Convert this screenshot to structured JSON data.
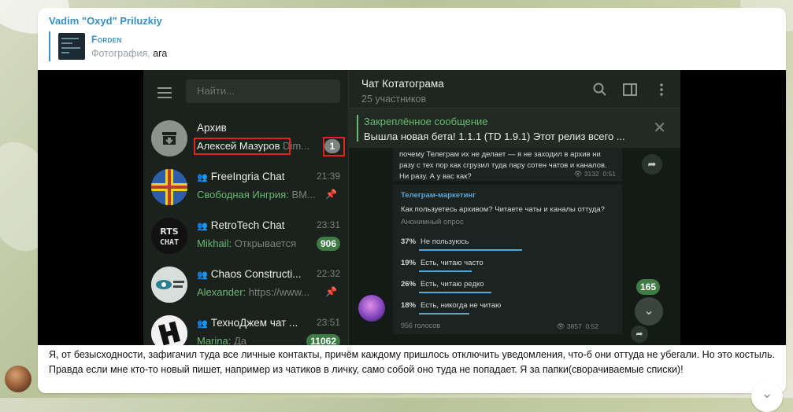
{
  "message": {
    "sender": "Vadim \"Oxyd\" Priluzkiy",
    "reply": {
      "title": "Forden",
      "type": "Фотография,",
      "text": "ага"
    },
    "caption": "Я, от безысходности, зафигачил туда все личные контакты, причём каждому пришлось отключить уведомления, что-б они оттуда не убегали. Но это костыль. Правда если мне кто-то новый пишет, например из чатиков в личку, само собой оно туда не попадает. Я за папки(сворачиваемые списки)!"
  },
  "screenshot": {
    "search_placeholder": "Найти...",
    "chats": [
      {
        "name": "Архив",
        "preview_who": "Алексей Мазуров",
        "preview": " Dim...",
        "time": "",
        "badge": "1"
      },
      {
        "name": "FreeIngria Chat",
        "preview_who": "Свободная Ингрия:",
        "preview": " BM...",
        "time": "21:39",
        "badge": ""
      },
      {
        "name": "RetroTech Chat",
        "preview_who": "Mikhail:",
        "preview": " Открывается",
        "time": "23:31",
        "badge": "906"
      },
      {
        "name": "Chaos Constructi...",
        "preview_who": "Alexander:",
        "preview": " https://www...",
        "time": "22:32",
        "badge": ""
      },
      {
        "name": "ТехноДжем чат ...",
        "preview_who": "Marina:",
        "preview": " Да",
        "time": "23:51",
        "badge": "11062"
      }
    ],
    "chat_title": "Чат Котатограма",
    "chat_members": "25 участников",
    "pinned_label": "Закреплённое сообщение",
    "pinned_text": "Вышла новая бета! 1.1.1 (TD 1.9.1)  Этот релиз всего ...",
    "msg1_text": "почему Телеграм их не делает — я не заходил в архив ни разу с тех пор как сгрузил туда пару сотен чатов и каналов. Ни разу. А у вас как?",
    "msg1_views": "3132",
    "msg1_time": "0:51",
    "poll": {
      "channel": "Телеграм-маркетинг",
      "question": "Как пользуетесь архивом? Читаете чаты и каналы оттуда?",
      "kind": "Анонимный опрос",
      "options": [
        {
          "pct": "37%",
          "label": "Не пользуюсь",
          "value": 37
        },
        {
          "pct": "19%",
          "label": "Есть, читаю часто",
          "value": 19
        },
        {
          "pct": "26%",
          "label": "Есть, читаю редко",
          "value": 26
        },
        {
          "pct": "18%",
          "label": "Есть, никогда не читаю",
          "value": 18
        }
      ],
      "votes": "956 голосов",
      "views": "3857",
      "time": "0:52"
    },
    "unread_counter": "165"
  },
  "icons": {
    "group": "group-icon",
    "pin": "pin-icon",
    "search": "search-icon",
    "sidebar": "sidebar-toggle-icon",
    "more": "more-vert-icon"
  }
}
